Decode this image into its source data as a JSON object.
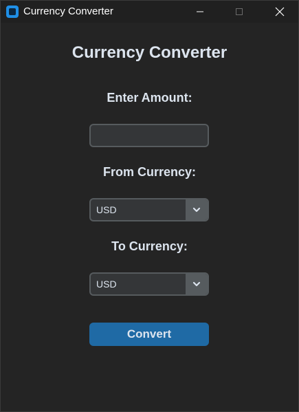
{
  "window": {
    "title": "Currency Converter"
  },
  "main": {
    "heading": "Currency Converter",
    "amount_label": "Enter Amount:",
    "amount_value": "",
    "from_label": "From Currency:",
    "from_value": "USD",
    "to_label": "To Currency:",
    "to_value": "USD",
    "convert_label": "Convert"
  },
  "colors": {
    "background": "#242424",
    "titlebar": "#202020",
    "accent": "#1f6aa5",
    "text": "#dce4ee",
    "field_bg": "#343638",
    "field_border": "#565b5e"
  },
  "icons": {
    "app": "app-icon",
    "minimize": "minimize-icon",
    "maximize": "maximize-icon",
    "close": "close-icon",
    "dropdown": "chevron-down-icon"
  }
}
